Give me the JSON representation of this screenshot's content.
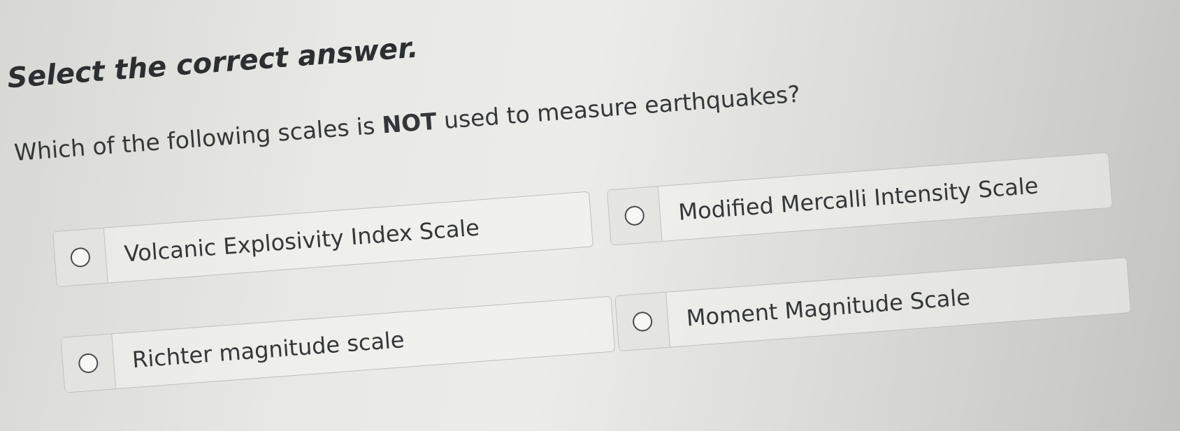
{
  "instruction": "Select the correct answer.",
  "question": {
    "before": "Which of the following scales is ",
    "emphasis": "NOT",
    "after": " used to measure earthquakes?"
  },
  "options": [
    {
      "label": "Volcanic Explosivity Index Scale",
      "selected": false
    },
    {
      "label": "Modified Mercalli Intensity Scale",
      "selected": false
    },
    {
      "label": "Richter magnitude scale",
      "selected": false
    },
    {
      "label": "Moment Magnitude Scale",
      "selected": false
    }
  ]
}
